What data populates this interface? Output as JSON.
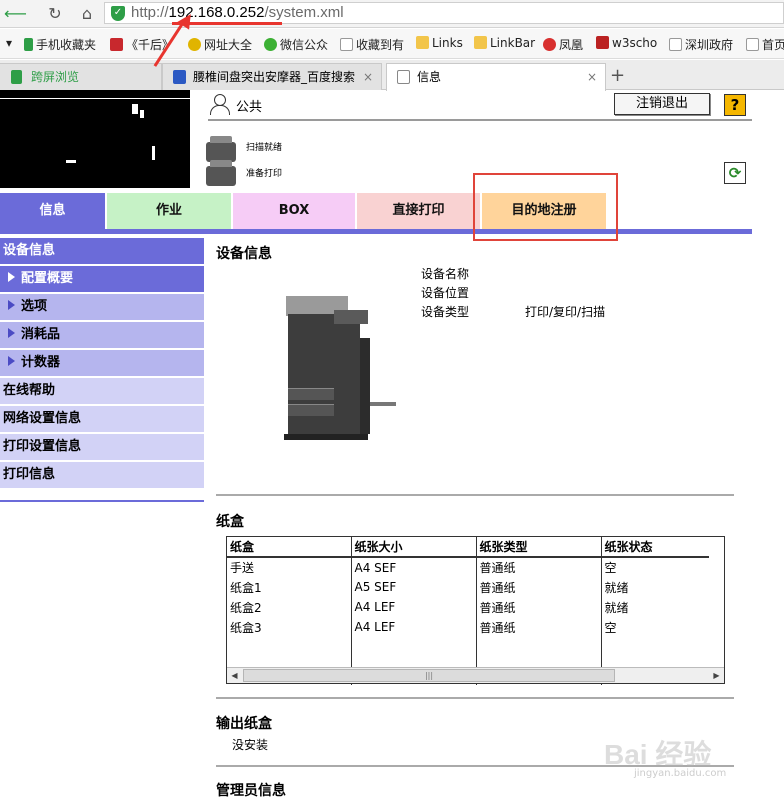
{
  "browser": {
    "url_scheme": "http://",
    "url_host": "192.168.0.252",
    "url_path": "/system.xml",
    "bookmarks": [
      "手机收藏夹",
      "《千后》",
      "网址大全",
      "微信公众",
      "收藏到有",
      "Links",
      "LinkBar",
      "凤凰",
      "w3scho",
      "深圳政府",
      "首页"
    ],
    "tabs": [
      {
        "label": "跨屏浏览"
      },
      {
        "label": "腰椎间盘突出安摩器_百度搜索"
      },
      {
        "label": "信息"
      }
    ],
    "new_tab": "+",
    "close_glyph": "×"
  },
  "header": {
    "user": "公共",
    "logout": "注销退出",
    "help": "?",
    "status_scan": "扫描就绪",
    "status_print": "准备打印"
  },
  "main_tabs": [
    {
      "label": "信息",
      "bg": "#6b6bd9",
      "color": "#ffffff"
    },
    {
      "label": "作业",
      "bg": "#c6f2c6",
      "color": "#111111"
    },
    {
      "label": "BOX",
      "bg": "#f6ccf6",
      "color": "#111111"
    },
    {
      "label": "直接打印",
      "bg": "#f9d2d2",
      "color": "#111111"
    },
    {
      "label": "目的地注册",
      "bg": "#ffd49b",
      "color": "#111111"
    }
  ],
  "sidebar": {
    "items": [
      {
        "label": "设备信息"
      },
      {
        "label": "配置概要"
      },
      {
        "label": "选项"
      },
      {
        "label": "消耗品"
      },
      {
        "label": "计数器"
      },
      {
        "label": "在线帮助"
      },
      {
        "label": "网络设置信息"
      },
      {
        "label": "打印设置信息"
      },
      {
        "label": "打印信息"
      }
    ]
  },
  "device": {
    "title": "设备信息",
    "name_label": "设备名称",
    "location_label": "设备位置",
    "type_label": "设备类型",
    "type_value": "打印/复印/扫描"
  },
  "trays": {
    "title": "纸盒",
    "headers": [
      "纸盒",
      "纸张大小",
      "纸张类型",
      "纸张状态"
    ],
    "rows": [
      [
        "手送",
        "A4 SEF",
        "普通纸",
        "空"
      ],
      [
        "纸盒1",
        "A5 SEF",
        "普通纸",
        "就绪"
      ],
      [
        "纸盒2",
        "A4 LEF",
        "普通纸",
        "就绪"
      ],
      [
        "纸盒3",
        "A4 LEF",
        "普通纸",
        "空"
      ]
    ]
  },
  "output": {
    "title": "输出纸盒",
    "value": "没安装"
  },
  "admin": {
    "title": "管理员信息"
  },
  "watermark": {
    "text": "Bai 经验",
    "sub": "jingyan.baidu.com"
  }
}
